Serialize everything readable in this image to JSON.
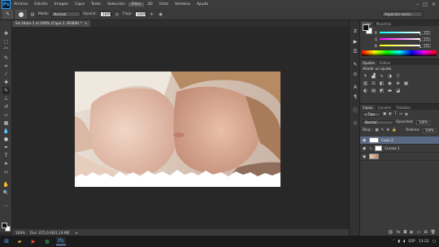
{
  "app": {
    "logo": "Ps",
    "menu": [
      "Archivo",
      "Edición",
      "Imagen",
      "Capa",
      "Texto",
      "Selección",
      "Filtro",
      "3D",
      "Vista",
      "Ventana",
      "Ayuda"
    ],
    "active_menu_index": 6
  },
  "options_bar": {
    "mode_label": "Modo:",
    "mode_value": "Normal",
    "opacity_label": "Opacid.:",
    "opacity_value": "100%",
    "flow_label": "Flujo:",
    "flow_value": "100%",
    "workspace": "Aspectos esenc."
  },
  "document": {
    "tab_title": "Sin título-1 al 100% (Capa 2, RGB/8) *",
    "zoom": "100%",
    "doc_info": "Doc: 675,0 KB/1,19 MB"
  },
  "panels": {
    "color": {
      "tabs": [
        "Color",
        "Muestras"
      ],
      "sliders": [
        {
          "letter": "R",
          "value": "255"
        },
        {
          "letter": "G",
          "value": "255"
        },
        {
          "letter": "B",
          "value": "255"
        }
      ]
    },
    "adjustments": {
      "tabs": [
        "Ajustes",
        "Estilos"
      ],
      "title": "Añadir un ajuste"
    },
    "layers": {
      "tabs": [
        "Capas",
        "Canales",
        "Trazados"
      ],
      "filter_kind": "Tipo",
      "blend_mode": "Normal",
      "opacity_label": "Opacidad:",
      "opacity_value": "100%",
      "lock_label": "Bloq.:",
      "fill_label": "Relleno:",
      "fill_value": "100%",
      "layers": [
        {
          "name": "Capa 2",
          "selected": true
        },
        {
          "name": "Curvas 1",
          "selected": false
        },
        {
          "name": "",
          "selected": false
        }
      ]
    }
  },
  "taskbar": {
    "lang": "ESP",
    "time": "13:22"
  },
  "colors": {
    "accent": "#31a8ff",
    "selection": "#5a6a85"
  }
}
